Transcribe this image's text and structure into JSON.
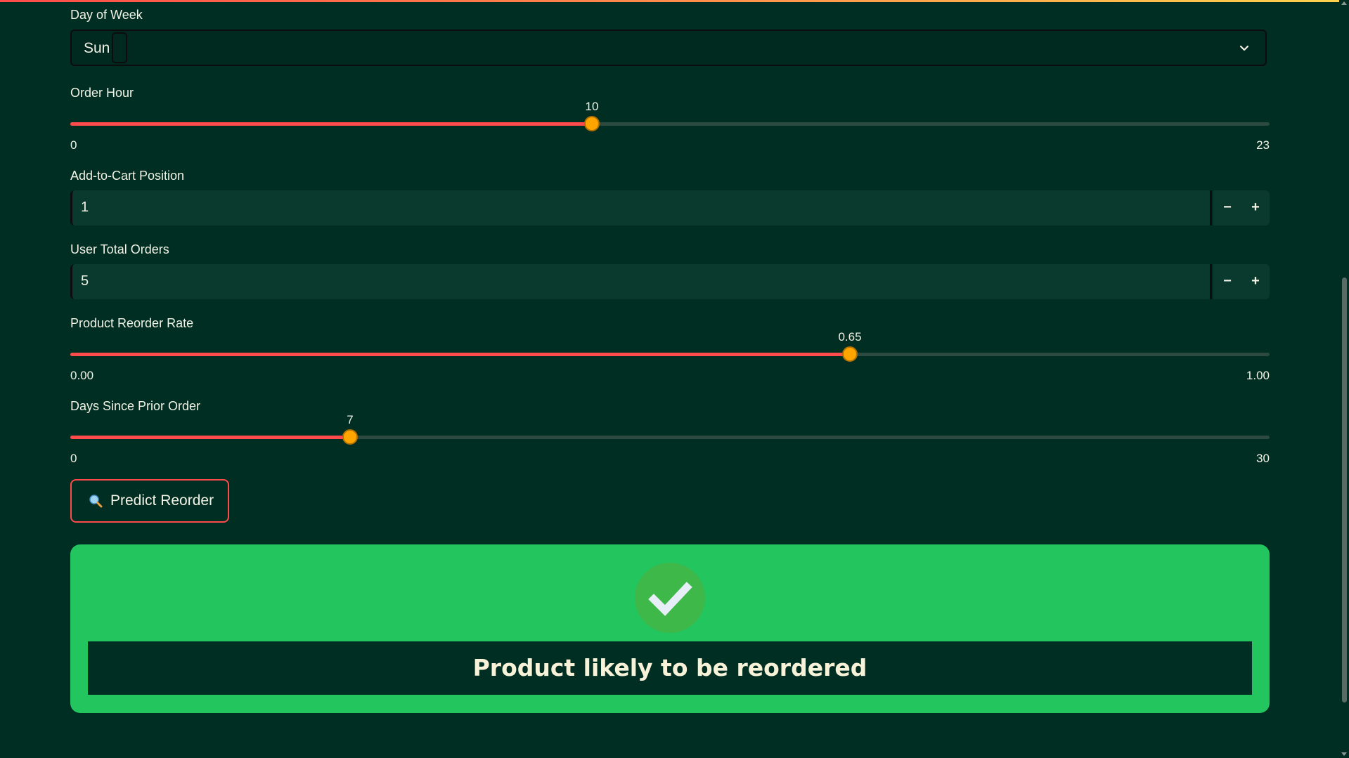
{
  "form": {
    "day_of_week": {
      "label": "Day of Week",
      "value": "Sun"
    },
    "order_hour": {
      "label": "Order Hour",
      "value": "10",
      "min": "0",
      "max": "23",
      "fraction": 0.4348
    },
    "add_to_cart": {
      "label": "Add-to-Cart Position",
      "value": "1",
      "minus": "−",
      "plus": "+"
    },
    "user_total_orders": {
      "label": "User Total Orders",
      "value": "5",
      "minus": "−",
      "plus": "+"
    },
    "reorder_rate": {
      "label": "Product Reorder Rate",
      "value": "0.65",
      "min": "0.00",
      "max": "1.00",
      "fraction": 0.65
    },
    "days_since_prior": {
      "label": "Days Since Prior Order",
      "value": "7",
      "min": "0",
      "max": "30",
      "fraction": 0.2333
    }
  },
  "button": {
    "label": "Predict Reorder",
    "icon": "magnifier-icon"
  },
  "result": {
    "text": "Product likely to be reordered",
    "icon": "check-icon",
    "status": "positive"
  },
  "colors": {
    "background": "#002e22",
    "accent": "#ff4b4b",
    "thumb": "#ffa500",
    "success": "#22c55e"
  }
}
